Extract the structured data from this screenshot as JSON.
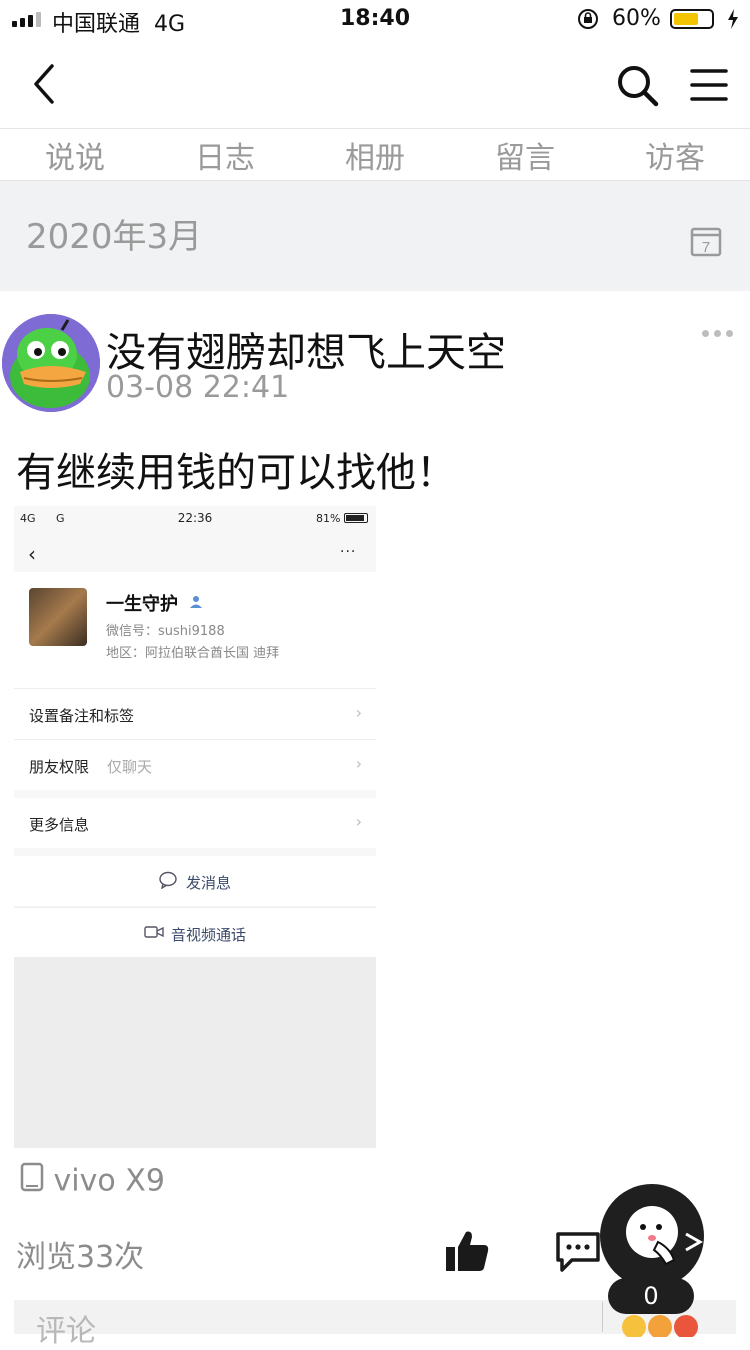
{
  "status_bar": {
    "carrier": "中国联通",
    "network": "4G",
    "time": "18:40",
    "battery": "60%"
  },
  "tabs": [
    "说说",
    "日志",
    "相册",
    "留言",
    "访客"
  ],
  "month": {
    "label": "2020年3月",
    "calendar_day": "7"
  },
  "post": {
    "author": "没有翅膀却想飞上天空",
    "time": "03-08 22:41",
    "text": "有继续用钱的可以找他！",
    "device": "vivo X9",
    "views": "浏览33次"
  },
  "screenshot": {
    "status": {
      "left": "4G",
      "left2": "G",
      "time": "22:36",
      "battery": "81%"
    },
    "name": "一生守护",
    "wechat_id": "微信号：sushi9188",
    "region": "地区：阿拉伯联合酋长国  迪拜",
    "rows": {
      "remark": "设置备注和标签",
      "permission": "朋友权限",
      "permission_value": "仅聊天",
      "more_info": "更多信息",
      "message": "发消息",
      "call": "音视频通话"
    }
  },
  "comment": {
    "placeholder": "评论"
  },
  "float_count": "0",
  "colors": {
    "accent_battery": "#f2c500",
    "muted_text": "#9a9a9a",
    "section_bg": "#f1f2f4"
  }
}
